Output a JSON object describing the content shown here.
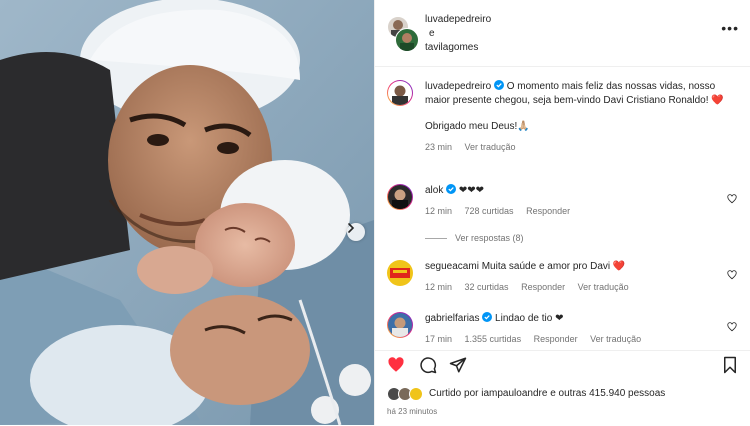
{
  "post": {
    "authors": [
      "luvadepedreiro",
      "tavilagomes"
    ],
    "joiner": "e",
    "more_label": "•••"
  },
  "caption": {
    "username": "luvadepedreiro",
    "text": "O momento mais feliz das nossas vidas, nosso maior presente chegou, seja bem-vindo Davi Cristiano Ronaldo! ❤️",
    "extra": "Obrigado meu Deus!🙏🏼",
    "time": "23 min",
    "translate": "Ver tradução"
  },
  "comments": [
    {
      "username": "alok",
      "verified": true,
      "text": "❤❤❤",
      "time": "12 min",
      "likes": "728 curtidas",
      "reply": "Responder",
      "translate": ""
    },
    {
      "username": "segueacami",
      "verified": false,
      "text": "Muita saúde e amor pro Davi ❤️",
      "time": "12 min",
      "likes": "32 curtidas",
      "reply": "Responder",
      "translate": "Ver tradução"
    },
    {
      "username": "gabrielfarias",
      "verified": true,
      "text": "Lindao de tio ❤",
      "time": "17 min",
      "likes": "1.355 curtidas",
      "reply": "Responder",
      "translate": "Ver tradução"
    }
  ],
  "replies_label": "Ver respostas (8)",
  "likes": {
    "prefix": "Curtido por",
    "user": "iampauloandre",
    "middle": "e",
    "others": "outras 415.940 pessoas"
  },
  "time_ago": "há 23 minutos",
  "icons": {
    "like": "heart-icon",
    "comment": "comment-icon",
    "share": "share-icon",
    "save": "bookmark-icon",
    "verified": "verified-badge-icon",
    "next": "chevron-right-icon"
  },
  "colors": {
    "like_active": "#ff3040",
    "verified": "#0095f6",
    "secondary_text": "#737373"
  }
}
